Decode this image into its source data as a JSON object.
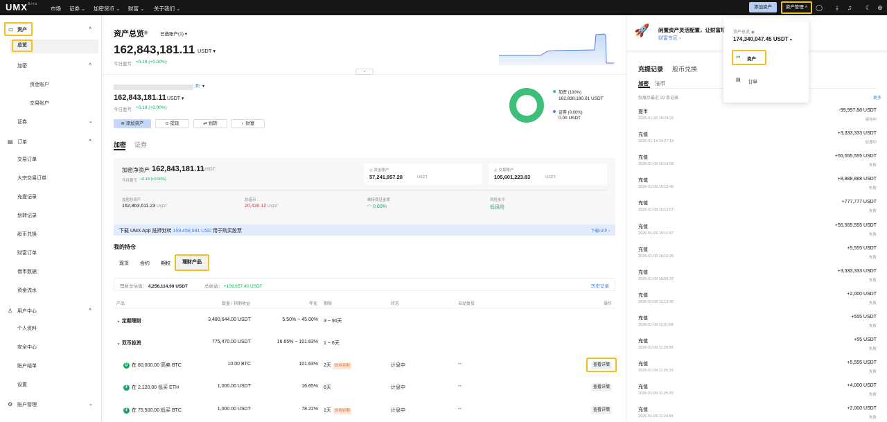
{
  "topbar": {
    "logo": "UMX",
    "logo_beta": "Beta",
    "nav": [
      "市场",
      "证券",
      "加密货币",
      "财富",
      "关于我们"
    ],
    "add_asset": "添加资产",
    "asset_mgmt": "资产管理"
  },
  "sidebar": {
    "assets": "资产",
    "overview": "总览",
    "crypto": "加密",
    "funding_account": "资金账户",
    "trading_account": "交易账户",
    "securities": "证券",
    "orders": "订单",
    "order_items": [
      "交易订单",
      "大宗交易订单",
      "充提记录",
      "划转记录",
      "股币兑换",
      "财富订单",
      "借币数据",
      "资金流水"
    ],
    "user_center": "用户中心",
    "user_items": [
      "个人资料",
      "安全中心",
      "账户结单",
      "设置"
    ],
    "account_mgmt": "账户管理"
  },
  "overview": {
    "title": "资产总览",
    "selected_accounts": "已选账户(1)",
    "total": "162,843,181.11",
    "currency": "USDT",
    "pnl_label": "今日盈亏",
    "pnl_value": "+0.18 (+0.00%)"
  },
  "account": {
    "tag": "B",
    "total": "162,843,181.11",
    "currency": "USDT",
    "pnl_label": "今日盈亏",
    "pnl_value": "+0.18 (+0.00%)",
    "buttons": [
      "添加资产",
      "提现",
      "划转",
      "财富"
    ],
    "legend_crypto": "加密 (100%)",
    "legend_crypto_value": "162,838,180.61 USDT",
    "legend_sec": "证券 (0.00%)",
    "legend_sec_value": "0.00 USDT"
  },
  "tabs": [
    "加密",
    "证券"
  ],
  "crypto_card": {
    "net_label": "加密净资产",
    "net_value": "162,843,181.11",
    "net_unit": "USDT",
    "pnl_label": "今日盈亏",
    "pnl_value": "+0.18 (+0.00%)",
    "funding_label": "资金账户",
    "funding_value": "57,241,957.28",
    "trading_label": "交易账户",
    "trading_value": "105,601,223.83",
    "unit": "USDT",
    "total_assets_label": "加密总资产",
    "total_assets_value": "162,863,611.23",
    "borrow_label": "总借币",
    "borrow_value": "20,430.12",
    "margin_label": "维持保证金率",
    "margin_value": "0.00%",
    "risk_label": "风险水平",
    "risk_value": "低风险"
  },
  "banner": {
    "prefix": "下载 UMX App 抵押划转",
    "amount": "159,458,081 USD",
    "suffix": "用于购买股票",
    "link": "下载APP"
  },
  "holdings": {
    "title": "我的持仓",
    "tabs": [
      "现货",
      "合约",
      "期权",
      "理财产品"
    ],
    "est_label": "理财总估值：",
    "est_value": "4,256,114.00 USDT",
    "income_label": "总收益：",
    "income_value": "+109,657.40 USDT",
    "history": "历史记录",
    "columns": [
      "产品",
      "数量 / 预期收益",
      "年化",
      "期限",
      "状态",
      "自动复投",
      "操作"
    ],
    "rows": [
      {
        "name": "定期理财",
        "qty": "3,480,644.00 USDT",
        "apr": "5.50% ~ 45.00%",
        "term": "3 ~ 90天",
        "status": "",
        "auto": "",
        "tag": ""
      },
      {
        "name": "双币投资",
        "qty": "775,470.00 USDT",
        "apr": "16.65% ~ 101.63%",
        "term": "1 ~ 6天",
        "status": "",
        "auto": "",
        "tag": ""
      },
      {
        "name": "在 80,000.00 高卖 BTC",
        "qty": "10.00 BTC",
        "apr": "101.63%",
        "term": "2天",
        "status": "计息中",
        "auto": "--",
        "tag": "即将到期",
        "action": "查看详情",
        "color": "#1aa760"
      },
      {
        "name": "在 2,120.00 低买 ETH",
        "qty": "1,000.00 USDT",
        "apr": "16.65%",
        "term": "6天",
        "status": "计息中",
        "auto": "--",
        "tag": "",
        "action": "查看详情",
        "color": "#26a17b"
      },
      {
        "name": "在 75,500.00 低买 BTC",
        "qty": "1,000.00 USDT",
        "apr": "78.22%",
        "term": "1天",
        "status": "计息中",
        "auto": "--",
        "tag": "即将到期",
        "action": "查看详情",
        "color": "#26a17b"
      }
    ]
  },
  "promo": {
    "text": "闲置资产灵活配置，让财富增值",
    "link": "财富专区"
  },
  "popup": {
    "label": "资产总览",
    "value": "174,340,047.45 USDT",
    "item_assets": "资产",
    "item_orders": "订单"
  },
  "records": {
    "tabs": [
      "充提记录",
      "股币兑换"
    ],
    "subtabs": [
      "加密",
      "法币"
    ],
    "note": "仅展示最近 20 条记录",
    "more": "更多",
    "items": [
      {
        "type": "提币",
        "time": "2026-01-20 15:24:32",
        "amount": "-99,997.88 USDT",
        "status": "审核中"
      },
      {
        "type": "充值",
        "time": "2026-01-14 14:27:13",
        "amount": "+3,333,333 USDT",
        "status": "处理中"
      },
      {
        "type": "充值",
        "time": "2026-01-09 16:14:09",
        "amount": "+55,555,555 USDT",
        "status": "失败"
      },
      {
        "type": "充值",
        "time": "2026-01-09 16:13:40",
        "amount": "+8,888,888 USDT",
        "status": "失败"
      },
      {
        "type": "充值",
        "time": "2026-01-09 16:12:57",
        "amount": "+777,777 USDT",
        "status": "失败"
      },
      {
        "type": "充值",
        "time": "2026-01-09 16:11:37",
        "amount": "+55,555,555 USDT",
        "status": "失败"
      },
      {
        "type": "充值",
        "time": "2026-01-09 16:10:26",
        "amount": "+5,555 USDT",
        "status": "失败"
      },
      {
        "type": "充值",
        "time": "2026-01-09 15:56:37",
        "amount": "+3,333,333 USDT",
        "status": "失败"
      },
      {
        "type": "充值",
        "time": "2026-01-09 15:13:42",
        "amount": "+2,000 USDT",
        "status": "失败"
      },
      {
        "type": "充值",
        "time": "2026-01-09 11:31:08",
        "amount": "+555 USDT",
        "status": "失败"
      },
      {
        "type": "充值",
        "time": "2026-01-09 11:29:56",
        "amount": "+55 USDT",
        "status": "失败"
      },
      {
        "type": "充值",
        "time": "2026-01-09 11:26:10",
        "amount": "+5,555 USDT",
        "status": "失败"
      },
      {
        "type": "充值",
        "time": "2026-01-09 11:25:20",
        "amount": "+4,000 USDT",
        "status": "失败"
      },
      {
        "type": "充值",
        "time": "2026-01-09 11:24:59",
        "amount": "+2,000 USDT",
        "status": "失败"
      }
    ]
  }
}
